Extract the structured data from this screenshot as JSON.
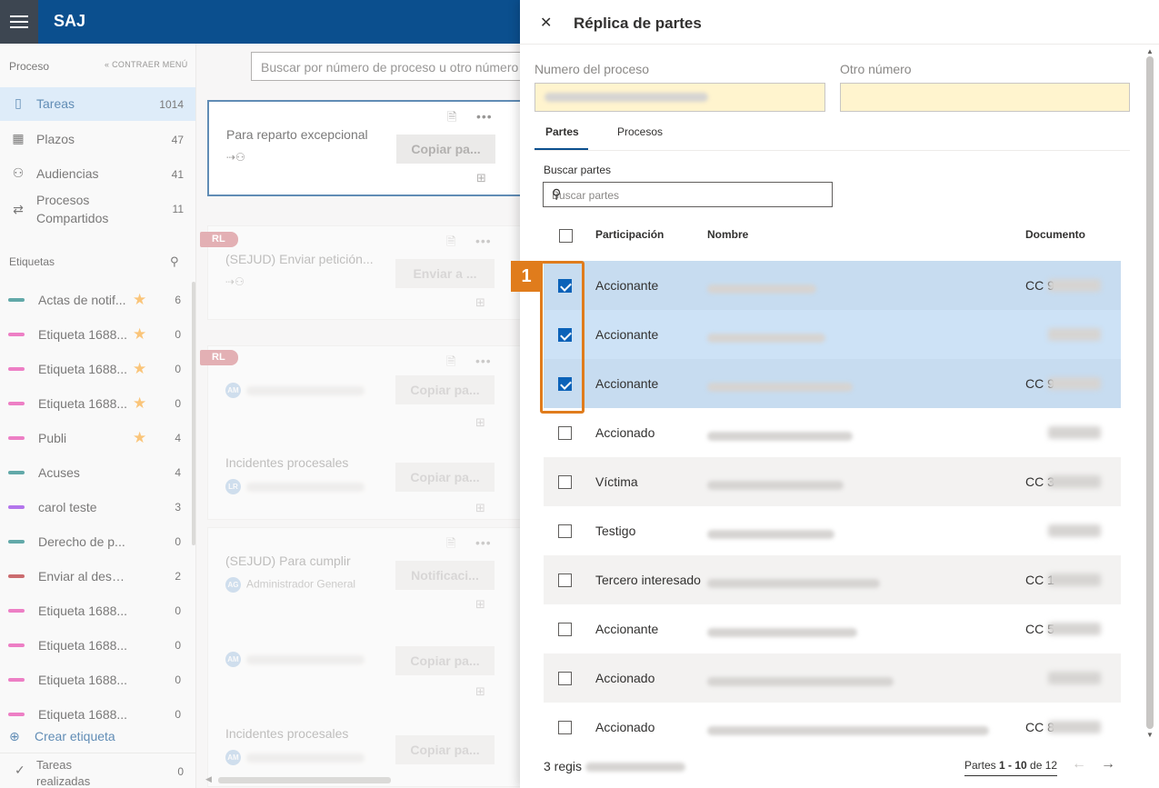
{
  "app": {
    "brand": "SAJ"
  },
  "sidebar": {
    "header": "Proceso",
    "collapse_label": "CONTRAER MENÚ",
    "nav": [
      {
        "label": "Tareas",
        "count": "1014",
        "icon": "tasks-icon"
      },
      {
        "label": "Plazos",
        "count": "47",
        "icon": "calendar-icon"
      },
      {
        "label": "Audiencias",
        "count": "41",
        "icon": "people-icon"
      },
      {
        "label": "Procesos Compartidos",
        "count": "11",
        "icon": "shared-icon"
      }
    ],
    "tags_title": "Etiquetas",
    "tags": [
      {
        "label": "Actas de notif...",
        "count": "6",
        "color": "#0f7b7b",
        "star": true
      },
      {
        "label": "Etiqueta 1688...",
        "count": "0",
        "color": "#e43ba6",
        "star": true
      },
      {
        "label": "Etiqueta 1688...",
        "count": "0",
        "color": "#e43ba6",
        "star": true
      },
      {
        "label": "Etiqueta 1688...",
        "count": "0",
        "color": "#e43ba6",
        "star": true
      },
      {
        "label": "Publi",
        "count": "4",
        "color": "#e43ba6",
        "star": true
      },
      {
        "label": "Acuses",
        "count": "4",
        "color": "#0f7b7b",
        "star": false
      },
      {
        "label": "carol teste",
        "count": "3",
        "color": "#8a2be2",
        "star": false
      },
      {
        "label": "Derecho de p...",
        "count": "0",
        "color": "#0f7b7b",
        "star": false
      },
      {
        "label": "Enviar al desp...",
        "count": "2",
        "color": "#b01e23",
        "star": false
      },
      {
        "label": "Etiqueta 1688...",
        "count": "0",
        "color": "#e43ba6",
        "star": false
      },
      {
        "label": "Etiqueta 1688...",
        "count": "0",
        "color": "#e43ba6",
        "star": false
      },
      {
        "label": "Etiqueta 1688...",
        "count": "0",
        "color": "#e43ba6",
        "star": false
      },
      {
        "label": "Etiqueta 1688...",
        "count": "0",
        "color": "#e43ba6",
        "star": false
      }
    ],
    "create_tag": "Crear etiqueta",
    "done": {
      "label": "Tareas realizadas",
      "count": "0"
    }
  },
  "main": {
    "search_placeholder": "Buscar por número de proceso u otro número",
    "cards": [
      {
        "title": "Para reparto excepcional",
        "button": "Copiar pa..."
      },
      {
        "badge": "RL",
        "title": "(SEJUD) Enviar petición...",
        "button": "Enviar a ..."
      },
      {
        "badge": "RL",
        "avatar": "AM",
        "button": "Copiar pa..."
      },
      {
        "title": "Incidentes procesales",
        "avatar": "LR",
        "button": "Copiar pa..."
      },
      {
        "title": "(SEJUD) Para cumplir",
        "avatar": "AG",
        "user": "Administrador General",
        "button": "Notificaci..."
      },
      {
        "avatar": "AM",
        "button": "Copiar pa..."
      },
      {
        "title": "Incidentes procesales",
        "avatar": "AM",
        "button": "Copiar pa..."
      }
    ]
  },
  "panel": {
    "title": "Réplica de partes",
    "numero_label": "Numero del proceso",
    "otro_label": "Otro número",
    "tabs": [
      "Partes",
      "Procesos"
    ],
    "search_label": "Buscar partes",
    "search_placeholder": "Buscar partes",
    "columns": [
      "Participación",
      "Nombre",
      "Documento"
    ],
    "rows": [
      {
        "participacion": "Accionante",
        "doc": "CC 9",
        "checked": true
      },
      {
        "participacion": "Accionante",
        "doc": "",
        "checked": true
      },
      {
        "participacion": "Accionante",
        "doc": "CC 9",
        "checked": true
      },
      {
        "participacion": "Accionado",
        "doc": "",
        "checked": false
      },
      {
        "participacion": "Víctima",
        "doc": "CC 3",
        "checked": false
      },
      {
        "participacion": "Testigo",
        "doc": "",
        "checked": false
      },
      {
        "participacion": "Tercero interesado",
        "doc": "CC 1",
        "checked": false
      },
      {
        "participacion": "Accionante",
        "doc": "CC 5",
        "checked": false
      },
      {
        "participacion": "Accionado",
        "doc": "",
        "checked": false
      },
      {
        "participacion": "Accionado",
        "doc": "CC 8",
        "checked": false
      }
    ],
    "footer_left": "3 regis",
    "footer_pager_prefix": "Partes ",
    "footer_pager_range": "1 - 10",
    "footer_pager_mid": " de ",
    "footer_pager_total": "12",
    "annotation": "1"
  }
}
